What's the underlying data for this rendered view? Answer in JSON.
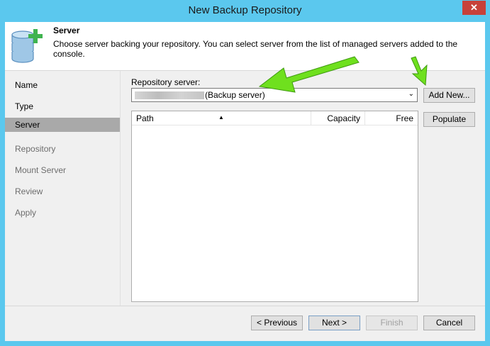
{
  "window": {
    "title": "New Backup Repository",
    "close_label": "✕"
  },
  "header": {
    "title": "Server",
    "description": "Choose server backing your repository. You can select server from the list of managed servers added to the console."
  },
  "nav": {
    "items": [
      {
        "label": "Name",
        "state": "done"
      },
      {
        "label": "Type",
        "state": "done"
      },
      {
        "label": "Server",
        "state": "active"
      },
      {
        "label": "Repository",
        "state": "pending"
      },
      {
        "label": "Mount Server",
        "state": "pending"
      },
      {
        "label": "Review",
        "state": "pending"
      },
      {
        "label": "Apply",
        "state": "pending"
      }
    ]
  },
  "form": {
    "repository_server_label": "Repository server:",
    "repository_server_value": "(Backup server)",
    "add_new_label": "Add New...",
    "populate_label": "Populate"
  },
  "table": {
    "columns": [
      "Path",
      "Capacity",
      "Free"
    ],
    "rows": []
  },
  "footer": {
    "previous_label": "< Previous",
    "next_label": "Next >",
    "finish_label": "Finish",
    "cancel_label": "Cancel"
  },
  "colors": {
    "accent": "#5bc8ee",
    "annotation_arrow": "#6fe01e",
    "close": "#c7413a"
  }
}
